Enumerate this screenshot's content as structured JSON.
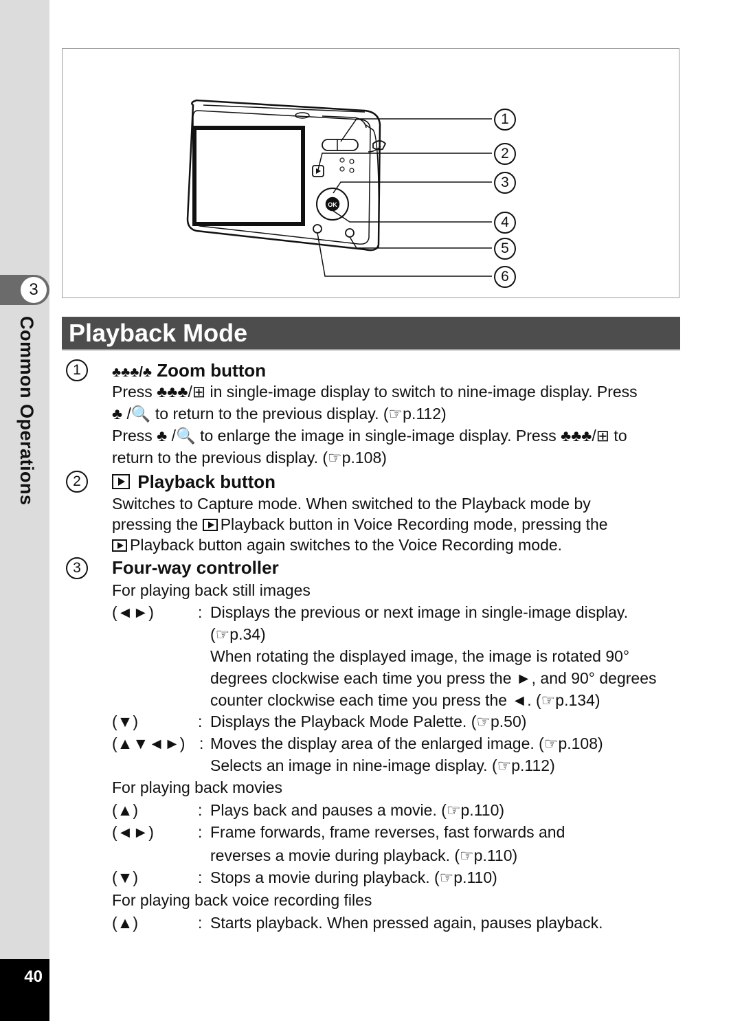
{
  "sidebar": {
    "chapter_number": "3",
    "chapter_title": "Common Operations",
    "page_number": "40"
  },
  "figure": {
    "callouts": [
      "1",
      "2",
      "3",
      "4",
      "5",
      "6"
    ],
    "button_label": "OK"
  },
  "section": {
    "title": "Playback Mode"
  },
  "items": [
    {
      "number": "1",
      "heading": "♣♣♣/♣ Zoom button",
      "heading_text": "Zoom button",
      "lines": [
        "Press ♣♣♣/⊞ in single-image display to switch to nine-image display. Press",
        "♣ /🔍 to return to the previous display. (☞p.112)",
        "Press ♣ /🔍 to enlarge the image in single-image display. Press ♣♣♣/⊞ to",
        "return to the previous display. (☞p.108)"
      ]
    },
    {
      "number": "2",
      "heading_text": "Playback button",
      "lines": [
        "Switches to Capture mode. When switched to the Playback mode by",
        "pressing the",
        "Playback button in Voice Recording mode, pressing the",
        "Playback button again switches to the Voice Recording mode."
      ]
    },
    {
      "number": "3",
      "heading_text": "Four-way controller",
      "groups": [
        {
          "title": "For playing back still images",
          "rows": [
            {
              "key": "(◄►)",
              "text": [
                "Displays the previous or next image in single-image display.",
                "(☞p.34)",
                "When rotating the displayed image, the image is rotated 90°",
                "degrees clockwise each time you press the ►, and 90° degrees",
                "counter clockwise each time you press the ◄. (☞p.134)"
              ]
            },
            {
              "key": "(▼)",
              "text": [
                "Displays the Playback Mode Palette. (☞p.50)"
              ]
            },
            {
              "key": "(▲▼◄►)",
              "text": [
                "Moves the display area of the enlarged image. (☞p.108)",
                "Selects an image in nine-image display. (☞p.112)"
              ]
            }
          ]
        },
        {
          "title": "For playing back movies",
          "rows": [
            {
              "key": "(▲)",
              "text": [
                "Plays back and pauses a movie. (☞p.110)"
              ]
            },
            {
              "key": "(◄►)",
              "text": [
                "Frame forwards, frame reverses, fast forwards and",
                "reverses a movie during playback. (☞p.110)"
              ]
            },
            {
              "key": "(▼)",
              "text": [
                "Stops a movie during playback. (☞p.110)"
              ]
            }
          ]
        },
        {
          "title": "For playing back voice recording files",
          "rows": [
            {
              "key": "(▲)",
              "text": [
                "Starts playback. When pressed again, pauses playback."
              ]
            }
          ]
        }
      ]
    }
  ],
  "colon": ":"
}
